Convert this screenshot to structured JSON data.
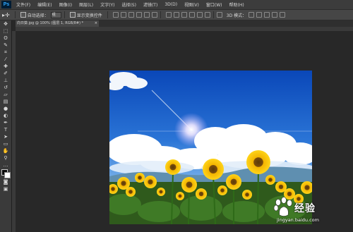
{
  "app": {
    "logo": "Ps"
  },
  "menu": [
    "文件(F)",
    "编辑(E)",
    "图像(I)",
    "图层(L)",
    "文字(Y)",
    "选择(S)",
    "滤镜(T)",
    "3D(D)",
    "视图(V)",
    "窗口(W)",
    "帮助(H)"
  ],
  "options": {
    "auto_select_label": "自动选择：",
    "auto_select_value": "组",
    "show_transform_label": "显示变换控件",
    "mode_3d_label": "3D 模式："
  },
  "document": {
    "tab_title": "向日葵.jpg @ 100% (图层 1, RGB/8#) *",
    "close_glyph": "×"
  },
  "watermark": {
    "brand": "经验",
    "url": "jingyan.baidu.com"
  },
  "colors": {
    "foreground": "#0b0b0b",
    "background": "#ffffff",
    "app_bg": "#282828"
  }
}
